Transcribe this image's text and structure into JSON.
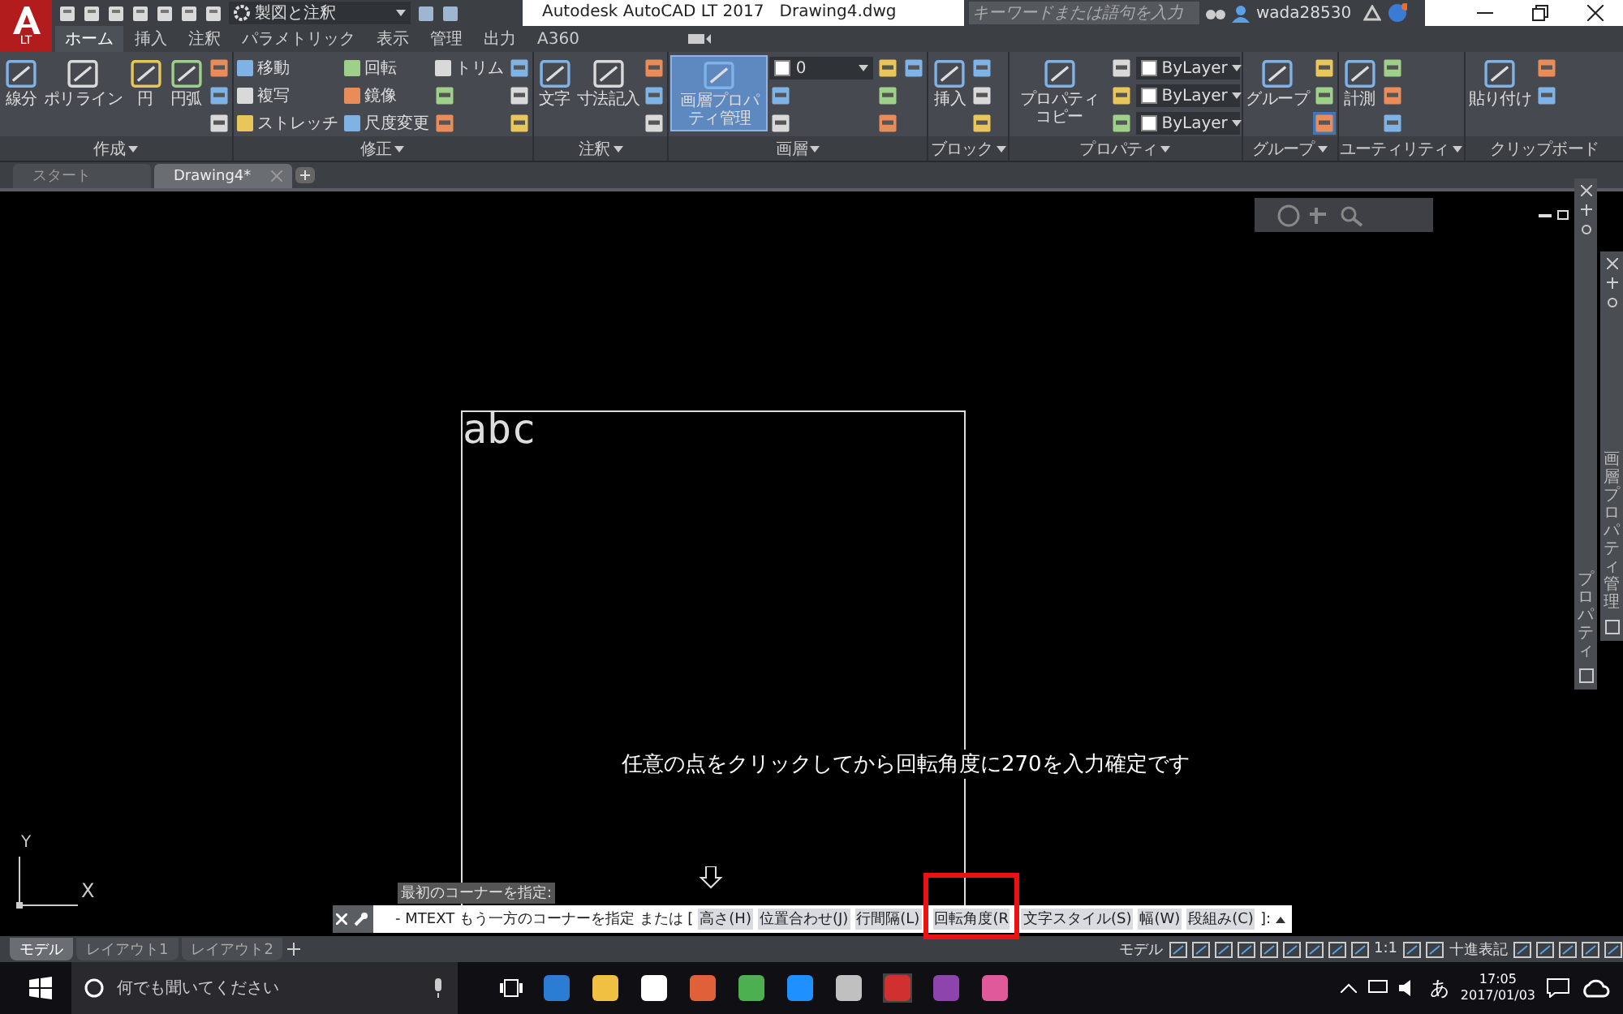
{
  "app_menu": {
    "label": "LT"
  },
  "quick_access": {
    "workspace": "製図と注釈"
  },
  "title_bar": {
    "title": "Autodesk AutoCAD LT 2017   Drawing4.dwg",
    "search": {
      "placeholder": "キーワードまたは語句を入力"
    },
    "user": "wada28530"
  },
  "ribbon_tabs": [
    {
      "label": "ホーム",
      "selected": true
    },
    {
      "label": "挿入",
      "selected": false
    },
    {
      "label": "注釈",
      "selected": false
    },
    {
      "label": "パラメトリック",
      "selected": false
    },
    {
      "label": "表示",
      "selected": false
    },
    {
      "label": "管理",
      "selected": false
    },
    {
      "label": "出力",
      "selected": false
    },
    {
      "label": "A360",
      "selected": false
    }
  ],
  "ribbon_panels": [
    {
      "title": "作成",
      "expandable": true,
      "tools": [
        {
          "kind": "large",
          "label": "線分",
          "highlighted": false
        },
        {
          "kind": "large",
          "label": "ポリライン",
          "highlighted": false
        },
        {
          "kind": "large",
          "label": "円",
          "highlighted": false
        },
        {
          "kind": "large",
          "label": "円弧",
          "highlighted": false
        },
        {
          "kind": "icon",
          "highlighted": false
        },
        {
          "kind": "icon",
          "highlighted": false
        },
        {
          "kind": "icon",
          "highlighted": false
        }
      ]
    },
    {
      "title": "修正",
      "expandable": true,
      "tools": [
        {
          "kind": "small",
          "label": "移動",
          "highlighted": false
        },
        {
          "kind": "small",
          "label": "複写",
          "highlighted": false
        },
        {
          "kind": "small",
          "label": "ストレッチ",
          "highlighted": false
        },
        {
          "kind": "small",
          "label": "回転",
          "highlighted": false
        },
        {
          "kind": "small",
          "label": "鏡像",
          "highlighted": false
        },
        {
          "kind": "small",
          "label": "尺度変更",
          "highlighted": false
        },
        {
          "kind": "small",
          "label": "トリム",
          "highlighted": false
        },
        {
          "kind": "icon",
          "highlighted": false
        },
        {
          "kind": "icon",
          "highlighted": false
        },
        {
          "kind": "icon",
          "highlighted": false
        },
        {
          "kind": "icon",
          "highlighted": false
        },
        {
          "kind": "icon",
          "highlighted": false
        }
      ]
    },
    {
      "title": "注釈",
      "expandable": true,
      "tools": [
        {
          "kind": "large",
          "label": "文字",
          "highlighted": false
        },
        {
          "kind": "large",
          "label": "寸法記入",
          "highlighted": false
        },
        {
          "kind": "icon",
          "highlighted": false
        },
        {
          "kind": "icon",
          "highlighted": false
        },
        {
          "kind": "icon",
          "highlighted": false
        }
      ]
    },
    {
      "title": "画層",
      "expandable": true,
      "tools": [
        {
          "kind": "large",
          "label": "画層プロパティ管理",
          "highlighted": true
        },
        {
          "kind": "dropdown",
          "value": "0",
          "highlighted": false
        },
        {
          "kind": "icon",
          "highlighted": false
        },
        {
          "kind": "icon",
          "highlighted": false
        },
        {
          "kind": "icon",
          "highlighted": false
        },
        {
          "kind": "icon",
          "highlighted": false
        },
        {
          "kind": "icon",
          "highlighted": false
        },
        {
          "kind": "icon",
          "highlighted": false
        }
      ]
    },
    {
      "title": "ブロック",
      "expandable": true,
      "tools": [
        {
          "kind": "large",
          "label": "挿入",
          "highlighted": false
        },
        {
          "kind": "icon",
          "highlighted": false
        },
        {
          "kind": "icon",
          "highlighted": false
        },
        {
          "kind": "icon",
          "highlighted": false
        }
      ]
    },
    {
      "title": "プロパティ",
      "expandable": true,
      "tools": [
        {
          "kind": "large",
          "label": "プロパティコピー",
          "highlighted": false
        },
        {
          "kind": "icon",
          "highlighted": false
        },
        {
          "kind": "icon",
          "highlighted": false
        },
        {
          "kind": "icon",
          "highlighted": false
        },
        {
          "kind": "dropdown",
          "value": "ByLayer",
          "highlighted": false
        },
        {
          "kind": "dropdown",
          "value": "ByLayer",
          "highlighted": false
        },
        {
          "kind": "dropdown",
          "value": "ByLayer",
          "highlighted": false
        }
      ]
    },
    {
      "title": "グループ",
      "expandable": true,
      "tools": [
        {
          "kind": "large",
          "label": "グループ",
          "highlighted": false
        },
        {
          "kind": "icon",
          "highlighted": false
        },
        {
          "kind": "icon",
          "highlighted": false
        },
        {
          "kind": "icon",
          "highlighted": true
        }
      ]
    },
    {
      "title": "ユーティリティ",
      "expandable": true,
      "tools": [
        {
          "kind": "large",
          "label": "計測",
          "highlighted": false
        },
        {
          "kind": "icon",
          "highlighted": false
        },
        {
          "kind": "icon",
          "highlighted": false
        },
        {
          "kind": "icon",
          "highlighted": false
        }
      ]
    },
    {
      "title": "クリップボード",
      "expandable": false,
      "tools": [
        {
          "kind": "large",
          "label": "貼り付け",
          "highlighted": false
        },
        {
          "kind": "icon",
          "highlighted": false
        },
        {
          "kind": "icon",
          "highlighted": false
        }
      ]
    }
  ],
  "doc_tabs": [
    {
      "label": "スタート",
      "selected": false
    },
    {
      "label": "Drawing4*",
      "selected": true
    }
  ],
  "canvas": {
    "mtext": "abc",
    "note": "任意の点をクリックしてから回転角度に270を入力確定です",
    "ucs": {
      "y": "Y",
      "x": "X"
    }
  },
  "palettes": [
    {
      "title": "プロパティ"
    },
    {
      "title": "画層プロパティ管理"
    }
  ],
  "command_line": {
    "history": "最初のコーナーを指定:",
    "prompt": "- MTEXT もう一方のコーナーを指定 または [",
    "options": [
      {
        "text": "高さ(H)",
        "framed": false
      },
      {
        "text": "位置合わせ(J)",
        "framed": false
      },
      {
        "text": "行間隔(L)",
        "framed": false
      },
      {
        "text": "回転角度(R",
        "framed": true
      },
      {
        "text": "文字スタイル(S)",
        "framed": false
      },
      {
        "text": "幅(W)",
        "framed": false
      },
      {
        "text": "段組み(C)",
        "framed": false
      }
    ],
    "end": "]:"
  },
  "layout_tabs": [
    {
      "label": "モデル",
      "selected": true
    },
    {
      "label": "レイアウト1",
      "selected": false
    },
    {
      "label": "レイアウト2",
      "selected": false
    }
  ],
  "status_bar": {
    "model": "モデル",
    "scale": "1:1",
    "units": "十進表記"
  },
  "taskbar": {
    "search": {
      "placeholder": "何でも聞いてください"
    },
    "ime": "あ",
    "time": "17:05",
    "date": "2017/01/03"
  }
}
